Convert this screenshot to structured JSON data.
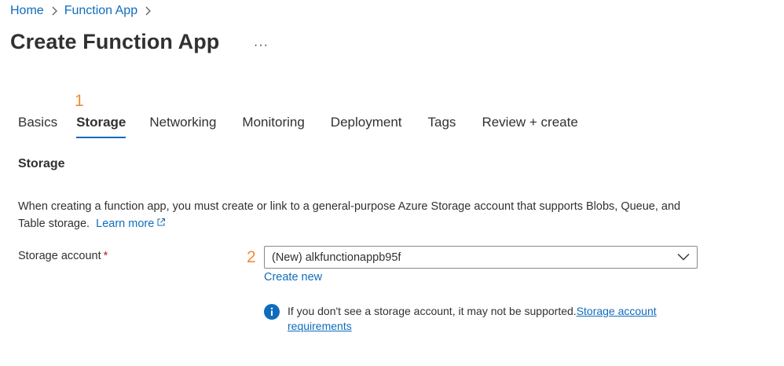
{
  "breadcrumb": {
    "items": [
      "Home",
      "Function App"
    ]
  },
  "page": {
    "title": "Create Function App",
    "more_label": "···"
  },
  "annotations": {
    "step1": "1",
    "step2": "2"
  },
  "tabs": [
    {
      "label": "Basics",
      "active": false
    },
    {
      "label": "Storage",
      "active": true
    },
    {
      "label": "Networking",
      "active": false
    },
    {
      "label": "Monitoring",
      "active": false
    },
    {
      "label": "Deployment",
      "active": false
    },
    {
      "label": "Tags",
      "active": false
    },
    {
      "label": "Review + create",
      "active": false
    }
  ],
  "storage": {
    "heading": "Storage",
    "description": "When creating a function app, you must create or link to a general-purpose Azure Storage account that supports Blobs, Queue, and Table storage.",
    "learn_more": "Learn more",
    "account_label": "Storage account",
    "required_marker": "*",
    "account_value": "(New) alkfunctionappb95f",
    "create_new": "Create new",
    "info_text": "If you don't see a storage account, it may not be supported.",
    "info_link": "Storage account requirements"
  },
  "colors": {
    "accent": "#0f6cbd",
    "annotation": "#f28b30",
    "required": "#a4262c"
  },
  "icons": [
    "chevron-right-icon",
    "more-icon",
    "external-link-icon",
    "chevron-down-icon",
    "info-icon"
  ]
}
